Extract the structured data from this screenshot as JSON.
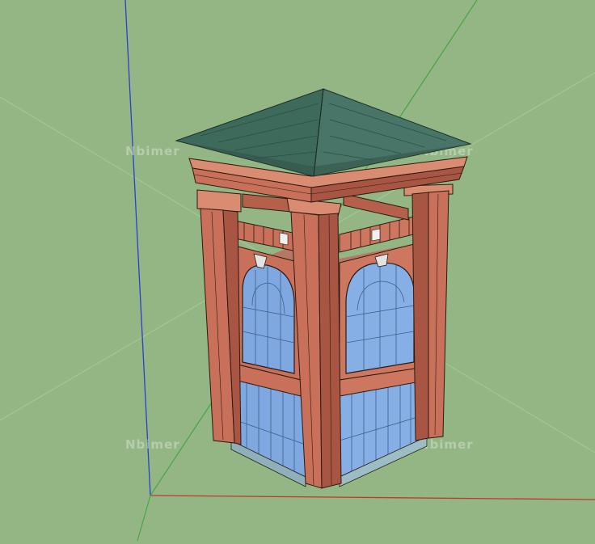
{
  "viewport": {
    "background": "#93b684",
    "model_name": "brick kiosk tower with pyramid tile roof"
  },
  "axes": {
    "blue": "#2c3fd0",
    "red": "#c0392b",
    "green": "#3ca33c"
  },
  "watermarks": [
    "Nbimer",
    "Nbimer",
    "Nbimer",
    "Nbimer"
  ],
  "colors": {
    "brick": "#c8705a",
    "brick_dark": "#a85643",
    "brick_light": "#d98c72",
    "roof": "#3e6a5c",
    "glass": "#7fa8e0",
    "edge": "#2a1a10"
  }
}
